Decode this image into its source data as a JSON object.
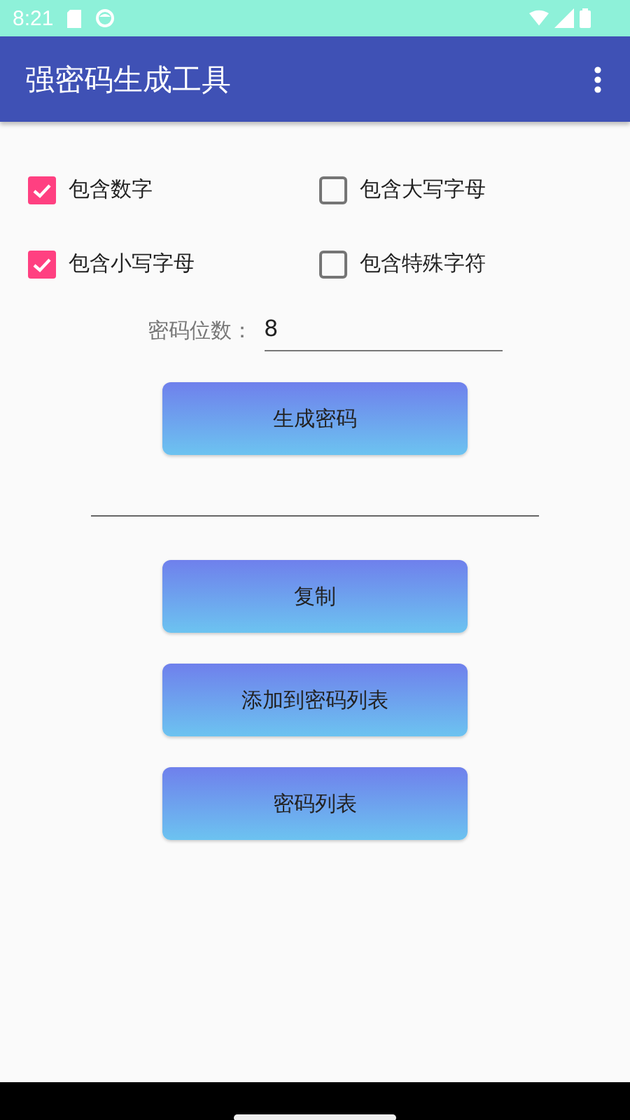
{
  "status_bar": {
    "time": "8:21"
  },
  "app_bar": {
    "title": "强密码生成工具"
  },
  "options": [
    {
      "label": "包含数字",
      "checked": true
    },
    {
      "label": "包含大写字母",
      "checked": false
    },
    {
      "label": "包含小写字母",
      "checked": true
    },
    {
      "label": "包含特殊字符",
      "checked": false
    }
  ],
  "length_field": {
    "label": "密码位数：",
    "value": "8"
  },
  "generate_button": "生成密码",
  "buttons": [
    "复制",
    "添加到密码列表",
    "密码列表"
  ]
}
